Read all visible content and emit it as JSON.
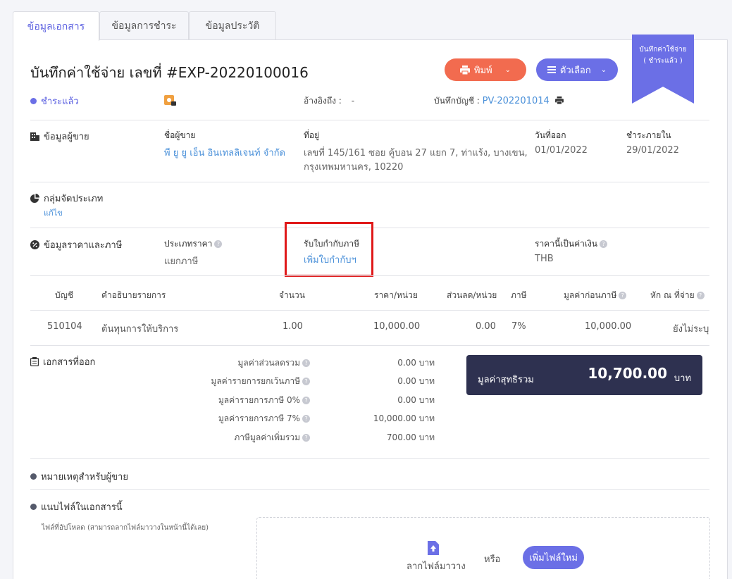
{
  "tabs": [
    {
      "label": "ข้อมูลเอกสาร"
    },
    {
      "label": "ข้อมูลการชำระ"
    },
    {
      "label": "ข้อมูลประวัติ"
    }
  ],
  "header": {
    "title": "บันทึกค่าใช้จ่าย เลขที่ #EXP-20220100016",
    "print_label": "พิมพ์",
    "options_label": "ตัวเลือก",
    "ribbon_line1": "บันทึกค่าใช้จ่าย",
    "ribbon_line2": "( ชำระแล้ว )",
    "status": "ชำระแล้ว",
    "ref_label": "อ้างอิงถึง :",
    "ref_value": "-",
    "journal_label": "บันทึกบัญชี :",
    "journal_value": "PV-202201014"
  },
  "seller": {
    "section_title": "ข้อมูลผู้ขาย",
    "name_label": "ชื่อผู้ขาย",
    "name_value": "พี ยู ยู เอ็น อินเทลลิเจนท์ จำกัด",
    "address_label": "ที่อยู่",
    "address_line1": "เลขที่ 145/161 ซอย คู้บอน 27 แยก 7, ท่าแร้ง, บางเขน,",
    "address_line2": "กรุงเทพมหานคร, 10220",
    "issue_label": "วันที่ออก",
    "issue_value": "01/01/2022",
    "due_label": "ชำระภายใน",
    "due_value": "29/01/2022"
  },
  "category": {
    "section_title": "กลุ่มจัดประเภท",
    "edit_label": "แก้ไข"
  },
  "price_tax": {
    "section_title": "ข้อมูลราคาและภาษี",
    "price_type_label": "ประเภทราคา",
    "price_type_value": "แยกภาษี",
    "tax_invoice_label": "รับใบกำกับภาษี",
    "tax_invoice_link": "เพิ่มใบกำกับฯ",
    "currency_label": "ราคานี้เป็นค่าเงิน",
    "currency_value": "THB"
  },
  "table": {
    "headers": {
      "account": "บัญชี",
      "description": "คำอธิบายรายการ",
      "qty": "จำนวน",
      "price": "ราคา/หน่วย",
      "discount": "ส่วนลด/หน่วย",
      "tax": "ภาษี",
      "pre_tax": "มูลค่าก่อนภาษี",
      "wht": "หัก ณ ที่จ่าย"
    },
    "rows": [
      {
        "account": "510104",
        "description": "ต้นทุนการให้บริการ",
        "qty": "1.00",
        "price": "10,000.00",
        "discount": "0.00",
        "tax": "7%",
        "pre_tax": "10,000.00",
        "wht": "ยังไม่ระบุ"
      }
    ]
  },
  "summary": {
    "section_title": "เอกสารที่ออก",
    "lines": [
      {
        "label": "มูลค่าส่วนลดรวม",
        "value": "0.00 บาท"
      },
      {
        "label": "มูลค่ารายการยกเว้นภาษี",
        "value": "0.00 บาท"
      },
      {
        "label": "มูลค่ารายการภาษี 0%",
        "value": "0.00 บาท"
      },
      {
        "label": "มูลค่ารายการภาษี 7%",
        "value": "10,000.00 บาท"
      },
      {
        "label": "ภาษีมูลค่าเพิ่มรวม",
        "value": "700.00 บาท"
      }
    ],
    "net_label": "มูลค่าสุทธิรวม",
    "net_value": "10,700.00",
    "net_unit": "บาท"
  },
  "notes": {
    "section_title": "หมายเหตุสำหรับผู้ขาย"
  },
  "attachments": {
    "section_title": "แนบไฟล์ในเอกสารนี้",
    "hint": "ไฟล์ที่อัปโหลด (สามารถลากไฟล์มาวางในหน้านี้ได้เลย)",
    "drag_label": "ลากไฟล์มาวาง",
    "or_label": "หรือ",
    "add_button": "เพิ่มไฟล์ใหม่"
  },
  "colors": {
    "accent": "#6b6fe6",
    "print_button": "#f26b4f",
    "link": "#4a90d9",
    "total_bg": "#2e3150",
    "highlight_box": "#e0191a"
  }
}
